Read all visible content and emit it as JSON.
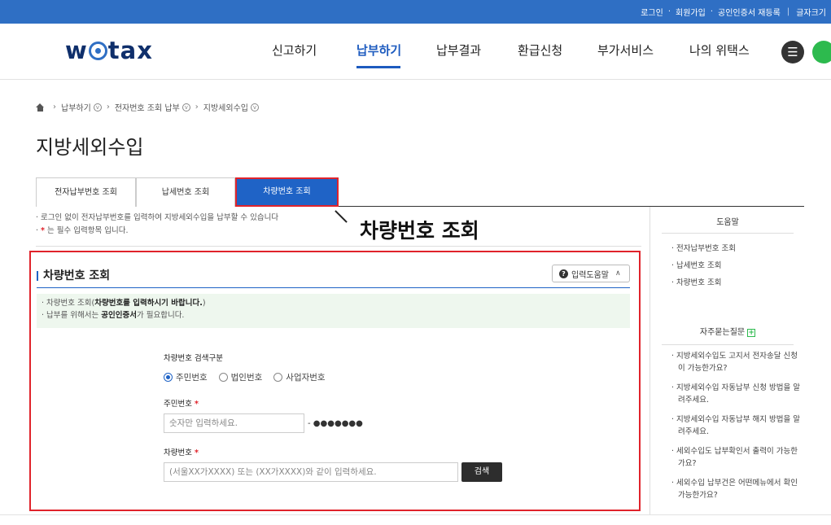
{
  "topbar": {
    "login": "로그인",
    "signup": "회원가입",
    "cert": "공인인증서 재등록",
    "font_size": "글자크기"
  },
  "header": {
    "logo": "w@tax",
    "nav": [
      "신고하기",
      "납부하기",
      "납부결과",
      "환급신청",
      "부가서비스",
      "나의 위택스"
    ],
    "active_nav": "납부하기"
  },
  "breadcrumb": [
    "납부하기",
    "전자번호 조회 납부",
    "지방세외수입"
  ],
  "page_title": "지방세외수입",
  "tabs": [
    {
      "label": "전자납부번호 조회",
      "active": false
    },
    {
      "label": "납세번호 조회",
      "active": false
    },
    {
      "label": "차량번호 조회",
      "active": true
    }
  ],
  "notice": {
    "line1": "· 로그인 없이 전자납부번호를 입력하여 지방세외수입을 납부할 수 있습니다",
    "line2_prefix": "· ",
    "line2_star": "*",
    "line2_suffix": " 는 필수 입력항목 입니다."
  },
  "callout": "차량번호 조회",
  "panel": {
    "title": "차량번호 조회",
    "help_button": "입력도움말",
    "info_line1_prefix": "· 차량번호 조회(",
    "info_line1_bold": "차량번호를 입력하시기 바랍니다.",
    "info_line1_suffix": ")",
    "info_line2_prefix": "· 납부를 위해서는 ",
    "info_line2_bold": "공인인증서",
    "info_line2_suffix": "가 필요합니다."
  },
  "form": {
    "search_type_label": "차량번호 검색구분",
    "options": [
      "주민번호",
      "법인번호",
      "사업자번호"
    ],
    "selected_option": "주민번호",
    "id_label": "주민번호",
    "id_placeholder": "숫자만 입력하세요.",
    "id_masked": "- ●●●●●●●",
    "car_label": "차량번호",
    "car_placeholder": "(서울XX가XXXX) 또는 (XX가XXXX)와 같이 입력하세요.",
    "search_button": "검색",
    "required_mark": "*"
  },
  "sidebar": {
    "help_title": "도움말",
    "help_links": [
      "전자납부번호 조회",
      "납세번호 조회",
      "차량번호 조회"
    ],
    "faq_title": "자주묻는질문",
    "faq": [
      "지방세외수입도 고지서 전자송달 신청이 가능한가요?",
      "지방세외수입 자동납부 신청 방법을 알려주세요.",
      "지방세외수입 자동납부 해지 방법을 알려주세요.",
      "세외수입도 납부확인서 출력이 가능한가요?",
      "세외수입 납부건은 어떤메뉴에서 확인가능한가요?"
    ]
  },
  "colors": {
    "brand_blue": "#2f6fc4",
    "tab_active": "#1f63c6",
    "highlight_red": "#e0232b",
    "info_bg": "#eef7ee"
  }
}
